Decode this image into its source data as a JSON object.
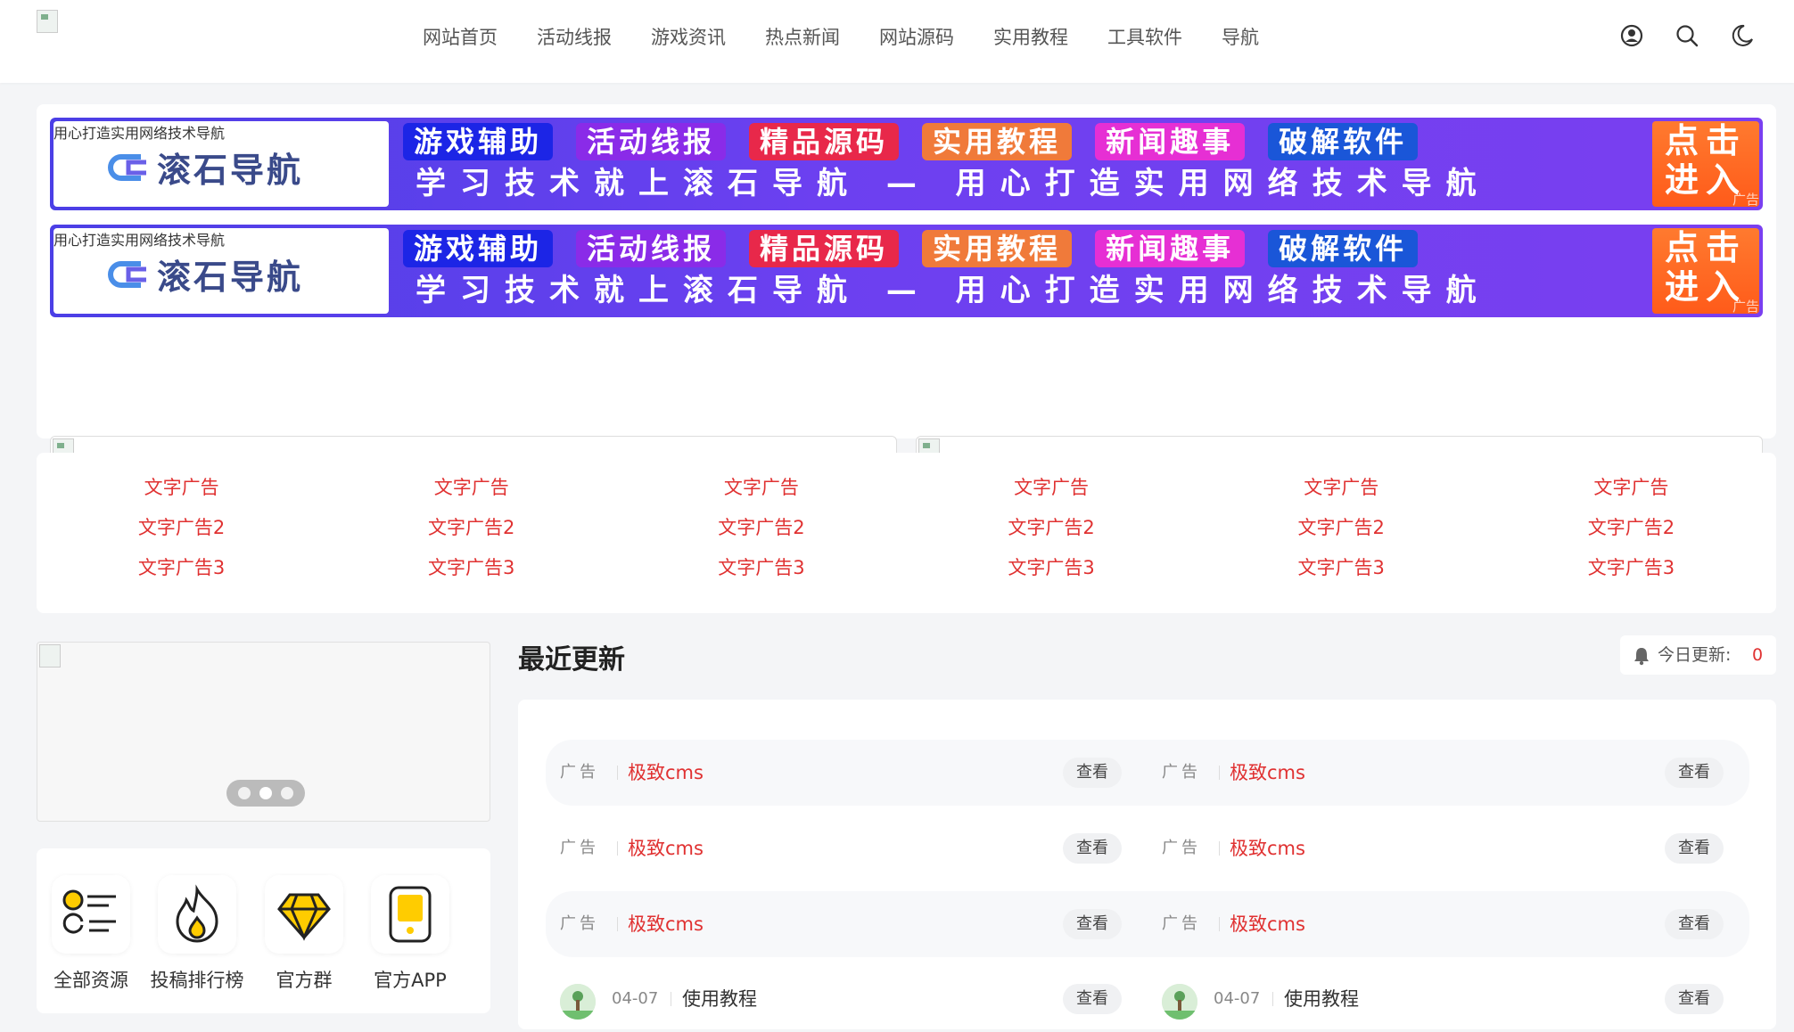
{
  "header": {
    "nav": [
      "网站首页",
      "活动线报",
      "游戏资讯",
      "热点新闻",
      "网站源码",
      "实用教程",
      "工具软件",
      "导航"
    ],
    "icons": [
      "user-icon",
      "search-icon",
      "moon-icon"
    ]
  },
  "banner": {
    "brand_name": "滚石导航",
    "brand_slogan": "用心打造实用网络技术导航",
    "tags": [
      {
        "label": "游戏辅助",
        "color": "#1c25e6"
      },
      {
        "label": "活动线报",
        "color": "#8a2be8"
      },
      {
        "label": "精品源码",
        "color": "#e8284a"
      },
      {
        "label": "实用教程",
        "color": "#f07a3a"
      },
      {
        "label": "新闻趣事",
        "color": "#e62fd4"
      },
      {
        "label": "破解软件",
        "color": "#1a56d8"
      }
    ],
    "line2": "学习技术就上滚石导航 — 用心打造实用网络技术导航",
    "enter_line1": "点击",
    "enter_line2": "进入",
    "ad_tag": "广告"
  },
  "image_ads": {
    "ad_tag": "广告"
  },
  "text_ads": {
    "rows": [
      [
        "文字广告",
        "文字广告",
        "文字广告",
        "文字广告",
        "文字广告",
        "文字广告"
      ],
      [
        "文字广告2",
        "文字广告2",
        "文字广告2",
        "文字广告2",
        "文字广告2",
        "文字广告2"
      ],
      [
        "文字广告3",
        "文字广告3",
        "文字广告3",
        "文字广告3",
        "文字广告3",
        "文字广告3"
      ]
    ]
  },
  "quick_links": [
    {
      "label": "全部资源",
      "icon": "list-icon"
    },
    {
      "label": "投稿排行榜",
      "icon": "fire-icon"
    },
    {
      "label": "官方群",
      "icon": "diamond-icon"
    },
    {
      "label": "官方APP",
      "icon": "phone-icon"
    }
  ],
  "recent": {
    "title": "最近更新",
    "today_label": "今日更新:",
    "today_count": "0",
    "rows": [
      [
        {
          "type": "ad",
          "key": "广告",
          "title": "极致cms",
          "btn": "查看"
        },
        {
          "type": "ad",
          "key": "广告",
          "title": "极致cms",
          "btn": "查看"
        }
      ],
      [
        {
          "type": "ad",
          "key": "广告",
          "title": "极致cms",
          "btn": "查看"
        },
        {
          "type": "ad",
          "key": "广告",
          "title": "极致cms",
          "btn": "查看"
        }
      ],
      [
        {
          "type": "ad",
          "key": "广告",
          "title": "极致cms",
          "btn": "查看"
        },
        {
          "type": "ad",
          "key": "广告",
          "title": "极致cms",
          "btn": "查看"
        }
      ],
      [
        {
          "type": "post",
          "date": "04-07",
          "category": "使用教程",
          "btn": "查看"
        },
        {
          "type": "post",
          "date": "04-07",
          "category": "使用教程",
          "btn": "查看"
        }
      ]
    ]
  },
  "colors": {
    "accent": "#e03131",
    "banner": "#6c40f0"
  }
}
